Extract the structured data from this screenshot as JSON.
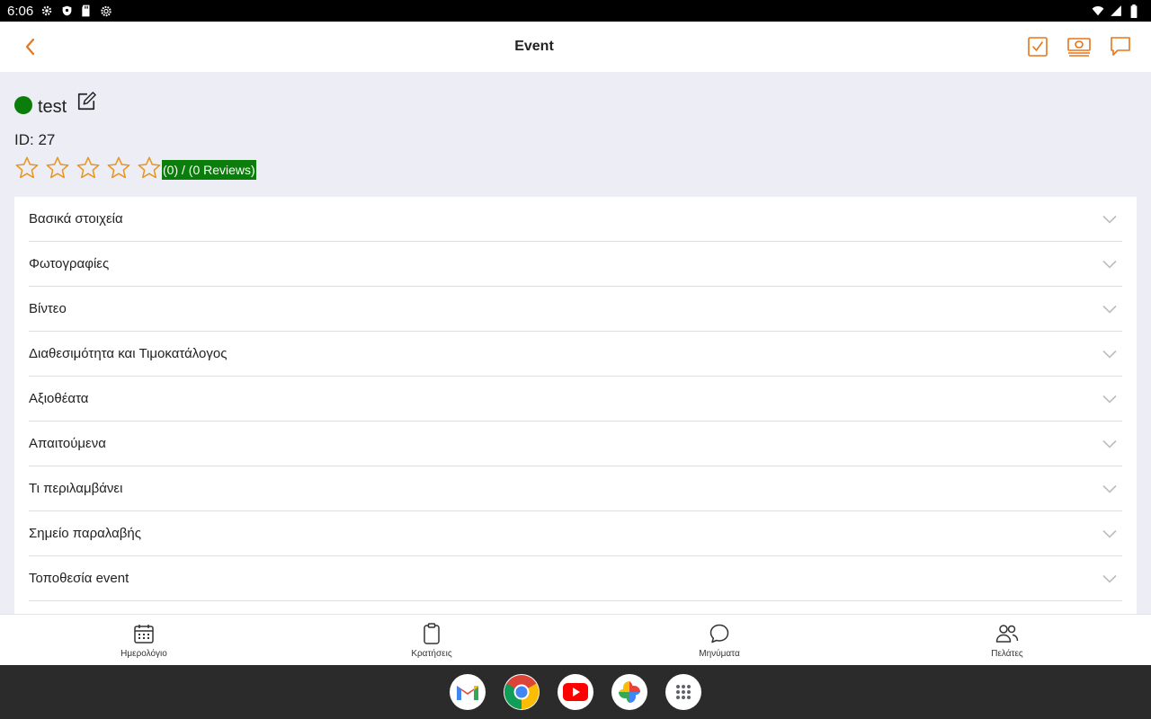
{
  "status_bar": {
    "time": "6:06",
    "left_icons": [
      "gear-icon",
      "shield-icon",
      "sd-card-icon",
      "settings-alt-icon"
    ],
    "right_icons": [
      "wifi-icon",
      "signal-icon",
      "battery-icon"
    ]
  },
  "appbar": {
    "title": "Event",
    "back_icon": "chevron-left-icon",
    "actions": [
      "checkbox-icon",
      "money-icon",
      "chat-bubble-icon"
    ],
    "accent_color": "#e8751a"
  },
  "event": {
    "name": "test",
    "status_color": "#0a7d0a",
    "id_text": "ID: 27",
    "rating_value": 0,
    "rating_max": 5,
    "rating_text": "(0) / (0 Reviews)"
  },
  "sections": [
    {
      "label": "Βασικά στοιχεία"
    },
    {
      "label": "Φωτογραφίες"
    },
    {
      "label": "Βίντεο"
    },
    {
      "label": "Διαθεσιμότητα και Τιμοκατάλογος"
    },
    {
      "label": "Αξιοθέατα"
    },
    {
      "label": "Απαιτούμενα"
    },
    {
      "label": "Τι περιλαμβάνει"
    },
    {
      "label": "Σημείο παραλαβής"
    },
    {
      "label": "Τοποθεσία event"
    }
  ],
  "bottom_nav": [
    {
      "label": "Ημερολόγιο",
      "icon": "calendar-icon"
    },
    {
      "label": "Κρατήσεις",
      "icon": "clipboard-icon"
    },
    {
      "label": "Μηνύματα",
      "icon": "messages-icon"
    },
    {
      "label": "Πελάτες",
      "icon": "users-icon"
    }
  ],
  "dock": [
    "gmail-icon",
    "chrome-icon",
    "youtube-icon",
    "photos-icon",
    "app-drawer-icon"
  ]
}
